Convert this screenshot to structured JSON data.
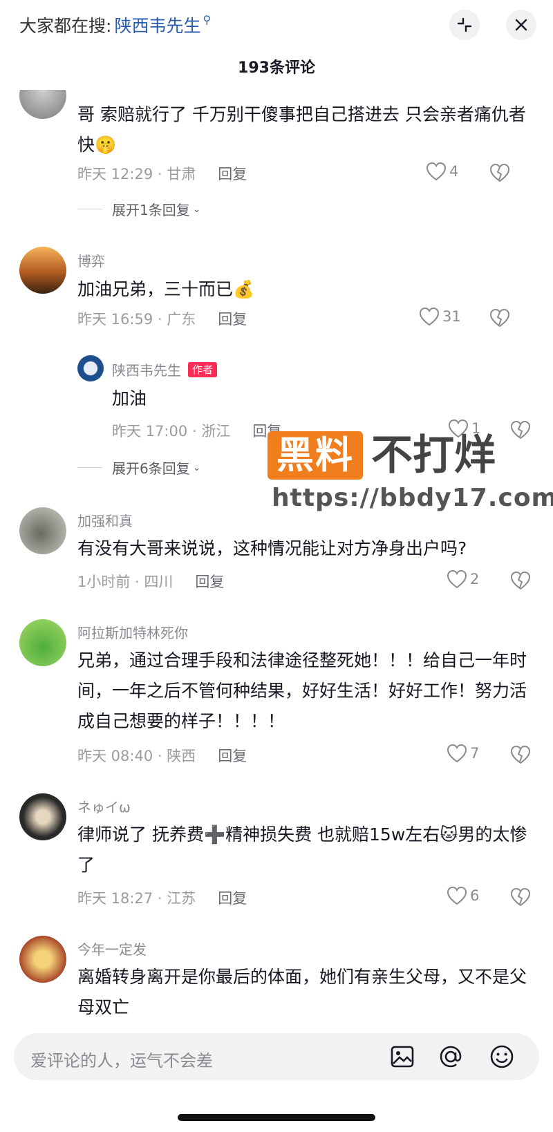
{
  "header": {
    "search_prefix": "大家都在搜:",
    "search_keyword": "陕西韦先生",
    "comment_count": "193条评论"
  },
  "comments": [
    {
      "username": "",
      "text": "哥  索赔就行了  千万别干傻事把自己搭进去   只会亲者痛仇者快🤫",
      "time_location": "昨天 12:29 · 甘肃",
      "reply_label": "回复",
      "likes": "4",
      "expand_label": "展开1条回复"
    },
    {
      "username": "博弈",
      "text": "加油兄弟，三十而已💰",
      "time_location": "昨天 16:59 · 广东",
      "reply_label": "回复",
      "likes": "31",
      "reply": {
        "username": "陕西韦先生",
        "badge": "作者",
        "text": "加油",
        "time_location": "昨天 17:00 · 浙江",
        "reply_label": "回复",
        "likes": "1"
      },
      "expand_label": "展开6条回复"
    },
    {
      "username": "加强和真",
      "text": "有没有大哥来说说，这种情况能让对方净身出户吗?",
      "time_location": "1小时前 · 四川",
      "reply_label": "回复",
      "likes": "2"
    },
    {
      "username": "阿拉斯加特林死你",
      "text": "兄弟，通过合理手段和法律途径整死她！！！给自己一年时间，一年之后不管何种结果，好好生活！好好工作！努力活成自己想要的样子！！！！",
      "time_location": "昨天 08:40 · 陕西",
      "reply_label": "回复",
      "likes": "7"
    },
    {
      "username": "ネゅイω",
      "text": "律师说了  抚养费➕精神损失费  也就赔15w左右🐱男的太惨了",
      "time_location": "昨天 18:27 · 江苏",
      "reply_label": "回复",
      "likes": "6"
    },
    {
      "username": "今年一定发",
      "text": "离婚转身离开是你最后的体面，她们有亲生父母，又不是父母双亡"
    }
  ],
  "watermark": {
    "box_text": "黑料",
    "text": "不打烊",
    "url": "https://bbdy17.com"
  },
  "input": {
    "placeholder": "爱评论的人，运气不会差"
  },
  "icons": [
    "collapse-icon",
    "close-icon",
    "heart-icon",
    "broken-heart-icon",
    "image-icon",
    "at-icon",
    "emoji-icon",
    "chevron-down-icon"
  ]
}
